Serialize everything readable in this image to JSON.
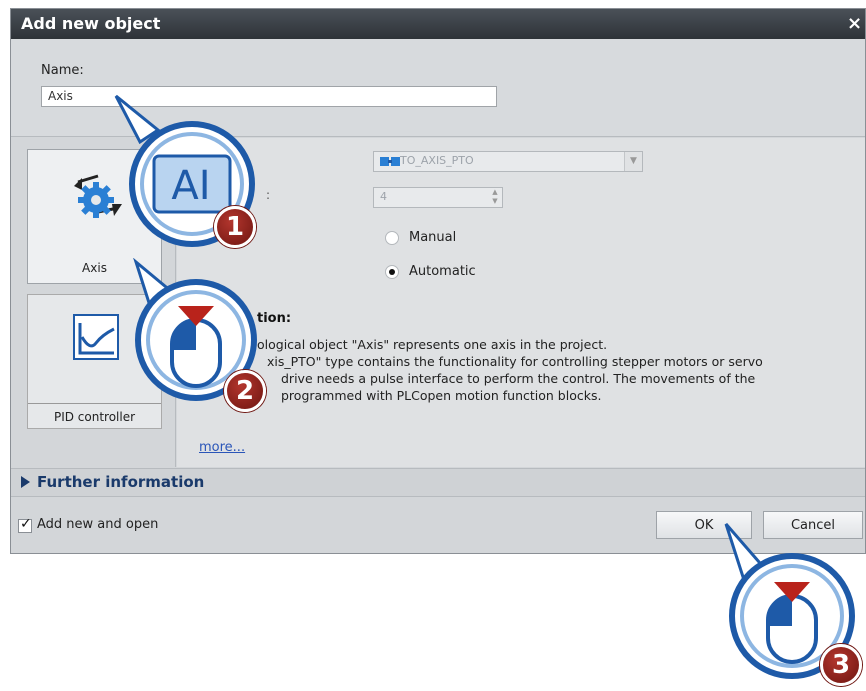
{
  "dialog": {
    "title": "Add new object",
    "close_symbol": "×"
  },
  "name_section": {
    "label": "Name:",
    "value": "Axis"
  },
  "object_types": [
    {
      "label": "Axis",
      "icon": "axis-icon",
      "selected": true
    },
    {
      "label": "PID controller",
      "icon": "pid-controller-icon",
      "selected": false
    }
  ],
  "settings": {
    "type_value": "TO_AXIS_PTO",
    "number_label_fragment": ":",
    "number_value": "4",
    "number_mode_options": [
      {
        "label": "Manual",
        "selected": false
      },
      {
        "label": "Automatic",
        "selected": true
      }
    ]
  },
  "description": {
    "heading_fragment": "tion:",
    "lines": [
      "ological object \"Axis\" represents one axis in the project.",
      "xis_PTO\" type contains the functionality for controlling stepper motors or servo",
      "drive needs a pulse interface to perform the control. The movements of the",
      "programmed with PLCopen motion function blocks."
    ],
    "more_link": "more..."
  },
  "further_information": {
    "label": "Further information"
  },
  "footer": {
    "checkbox_label": "Add new and open",
    "checkbox_checked": true,
    "ok_label": "OK",
    "cancel_label": "Cancel"
  },
  "callouts": {
    "step_1": {
      "number": "1",
      "icon": "text-field-icon",
      "glyph": "AI"
    },
    "step_2": {
      "number": "2",
      "icon": "mouse-left-click-icon"
    },
    "step_3": {
      "number": "3",
      "icon": "mouse-left-click-icon"
    }
  },
  "colors": {
    "titlebar": "#3a4046",
    "dialog_bg": "#d3d6d9",
    "further_info_text": "#1a3a6b",
    "link": "#2a55b8",
    "badge_red": "#8b1e17",
    "callout_blue": "#1e5aa8"
  }
}
